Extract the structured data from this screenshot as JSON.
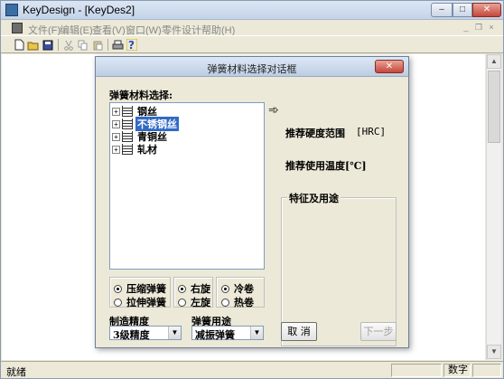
{
  "window": {
    "title": "KeyDesign - [KeyDes2]",
    "controls": {
      "minimize": "–",
      "maximize": "□",
      "close": "✕"
    }
  },
  "menubar": {
    "items": [
      "文件(F)",
      "编辑(E)",
      "查看(V)",
      "窗口(W)",
      "零件设计",
      "帮助(H)"
    ],
    "mdi_controls": {
      "minimize": "_",
      "restore": "❐",
      "close": "×"
    }
  },
  "toolbar": {
    "buttons": [
      "new-icon",
      "open-icon",
      "save-icon",
      "cut-icon",
      "copy-icon",
      "paste-icon",
      "print-icon",
      "help-icon"
    ]
  },
  "dialog": {
    "title": "弹簧材料选择对话框",
    "material_label": "弹簧材料选择:",
    "tree": [
      {
        "label": "钢丝",
        "selected": false
      },
      {
        "label": "不锈钢丝",
        "selected": true
      },
      {
        "label": "青铜丝",
        "selected": false
      },
      {
        "label": "轧材",
        "selected": false
      }
    ],
    "arrow": "➾",
    "hardness_label": "推荐硬度范围",
    "hardness_unit": "[HRC]",
    "temp_label": "推荐使用温度[℃]",
    "features_label": "特征及用途",
    "spring_type": {
      "options": [
        "压缩弹簧",
        "拉伸弹簧"
      ],
      "selected": 0
    },
    "rotation": {
      "options": [
        "右旋",
        "左旋"
      ],
      "selected": 0
    },
    "coiling": {
      "options": [
        "冷卷",
        "热卷"
      ],
      "selected": 0
    },
    "precision_label": "制造精度",
    "precision_value": "3级精度",
    "usage_label": "弹簧用途",
    "usage_value": "减振弹簧",
    "cancel_button": "取 消",
    "next_button": "下一步"
  },
  "statusbar": {
    "text": "就绪",
    "num": "数字"
  },
  "colors": {
    "selection": "#316ac5",
    "close_button": "#c6463a"
  }
}
